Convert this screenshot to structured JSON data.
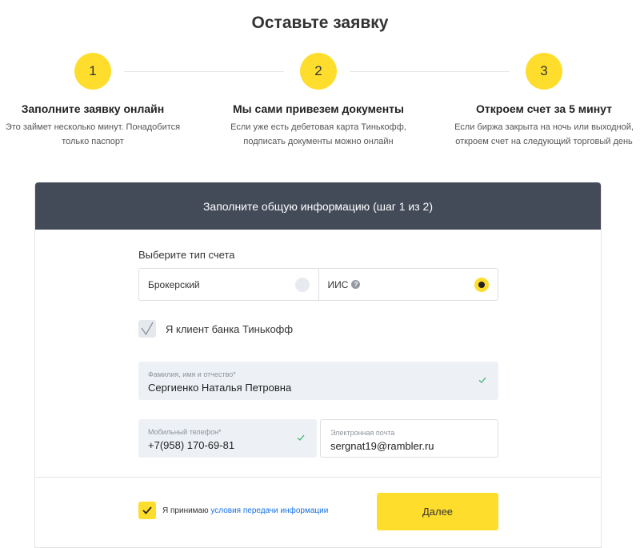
{
  "page_title": "Оставьте заявку",
  "steps": [
    {
      "number": "1",
      "title": "Заполните заявку онлайн",
      "description": "Это займет несколько минут. Понадобится\nтолько паспорт"
    },
    {
      "number": "2",
      "title": "Мы сами привезем документы",
      "description": "Если уже есть дебетовая карта Тинькофф,\nподписать документы можно онлайн"
    },
    {
      "number": "3",
      "title": "Откроем счет за 5 минут",
      "description": "Если биржа закрыта на ночь или выходной,\nоткроем счет на следующий торговый день"
    }
  ],
  "form": {
    "header": "Заполните общую информацию (шаг 1 из 2)",
    "account_type_label": "Выберите тип счета",
    "account_types": [
      {
        "label": "Брокерский",
        "selected": false
      },
      {
        "label": "ИИС",
        "selected": true
      }
    ],
    "bank_client": {
      "label": "Я клиент банка Тинькофф",
      "checked": true
    },
    "full_name": {
      "label": "Фамилия, имя и отчество*",
      "value": "Сергиенко Наталья Петровна"
    },
    "phone": {
      "label": "Мобильный телефон*",
      "value": "+7(958) 170-69-81"
    },
    "email": {
      "label": "Электронная почта",
      "value": "sergnat19@rambler.ru"
    },
    "consent": {
      "prefix": "Я принимаю ",
      "link": "условия передачи информации",
      "checked": true
    },
    "submit_label": "Далее"
  },
  "colors": {
    "accent": "#ffdd2d",
    "header_bg": "#434b59",
    "link": "#1771e6",
    "valid": "#3cb371"
  }
}
